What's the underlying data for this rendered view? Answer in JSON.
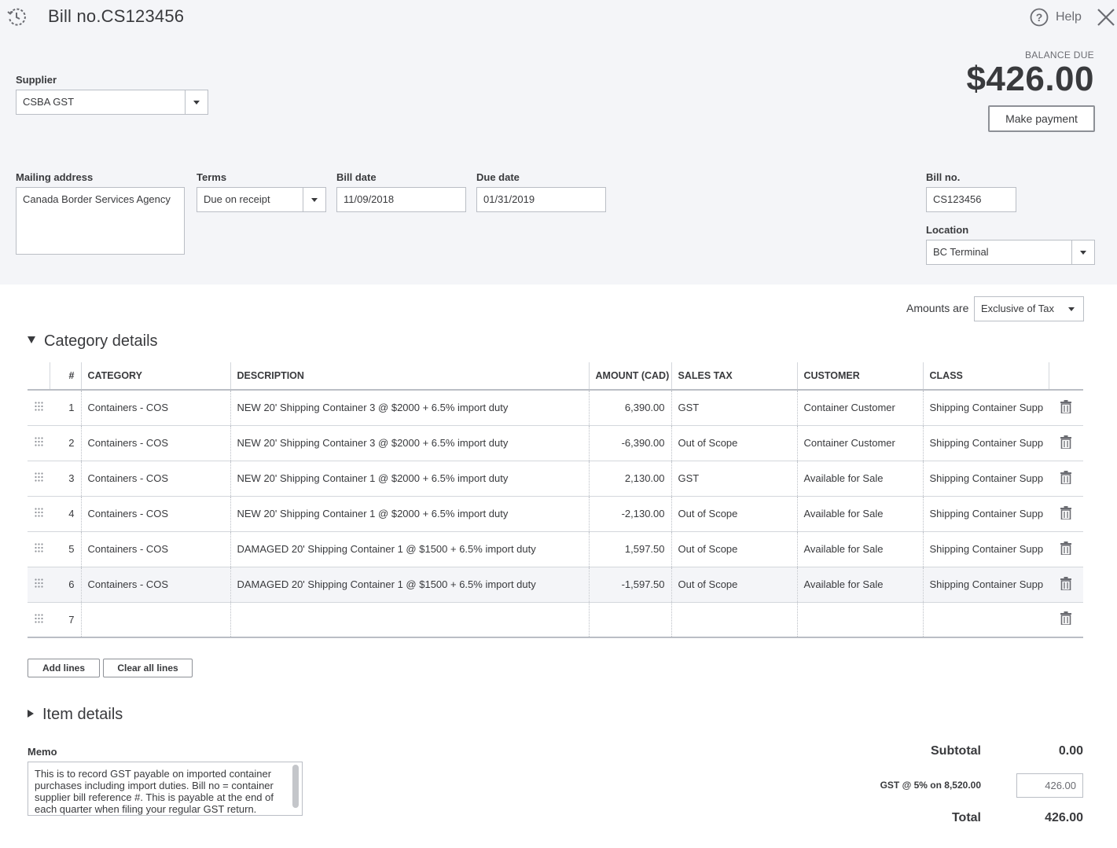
{
  "header": {
    "title": "Bill no.CS123456",
    "help_label": "Help",
    "icons": {
      "history": "history-icon",
      "help": "help-icon",
      "close": "close-icon"
    }
  },
  "supplier": {
    "label": "Supplier",
    "value": "CSBA GST"
  },
  "balance": {
    "label": "BALANCE DUE",
    "value": "$426.00",
    "button": "Make payment"
  },
  "mailing_address": {
    "label": "Mailing address",
    "value": "Canada Border Services Agency"
  },
  "terms": {
    "label": "Terms",
    "value": "Due on receipt"
  },
  "bill_date": {
    "label": "Bill date",
    "value": "11/09/2018"
  },
  "due_date": {
    "label": "Due date",
    "value": "01/31/2019"
  },
  "bill_no": {
    "label": "Bill no.",
    "value": "CS123456"
  },
  "location": {
    "label": "Location",
    "value": "BC Terminal"
  },
  "amounts_are": {
    "label": "Amounts are",
    "value": "Exclusive of Tax"
  },
  "category_details": {
    "title": "Category details",
    "columns": {
      "num": "#",
      "category": "CATEGORY",
      "description": "DESCRIPTION",
      "amount": "AMOUNT (CAD)",
      "sales_tax": "SALES TAX",
      "customer": "CUSTOMER",
      "class": "CLASS"
    },
    "rows": [
      {
        "num": "1",
        "category": "Containers - COS",
        "description": "NEW 20' Shipping Container 3 @ $2000 + 6.5% import duty",
        "amount": "6,390.00",
        "sales_tax": "GST",
        "customer": "Container Customer",
        "class": "Shipping Container Supp"
      },
      {
        "num": "2",
        "category": "Containers - COS",
        "description": "NEW 20' Shipping Container 3 @ $2000  + 6.5% import duty",
        "amount": "-6,390.00",
        "sales_tax": "Out of Scope",
        "customer": "Container Customer",
        "class": "Shipping Container Supp"
      },
      {
        "num": "3",
        "category": "Containers - COS",
        "description": "NEW 20' Shipping Container 1 @ $2000  + 6.5% import duty",
        "amount": "2,130.00",
        "sales_tax": "GST",
        "customer": "Available for Sale",
        "class": "Shipping Container Supp"
      },
      {
        "num": "4",
        "category": "Containers - COS",
        "description": "NEW 20' Shipping Container 1 @ $2000 + 6.5% import duty",
        "amount": "-2,130.00",
        "sales_tax": "Out of Scope",
        "customer": "Available for Sale",
        "class": "Shipping Container Supp"
      },
      {
        "num": "5",
        "category": "Containers - COS",
        "description": "DAMAGED  20' Shipping Container 1 @ $1500  + 6.5% import duty",
        "amount": "1,597.50",
        "sales_tax": "Out of Scope",
        "customer": "Available for Sale",
        "class": "Shipping Container Supp"
      },
      {
        "num": "6",
        "category": "Containers - COS",
        "description": "DAMAGED  20' Shipping Container 1 @ $1500  + 6.5% import duty",
        "amount": "-1,597.50",
        "sales_tax": "Out of Scope",
        "customer": "Available for Sale",
        "class": "Shipping Container Supp"
      },
      {
        "num": "7",
        "category": "",
        "description": "",
        "amount": "",
        "sales_tax": "",
        "customer": "",
        "class": ""
      }
    ],
    "add_lines": "Add lines",
    "clear_all_lines": "Clear all lines"
  },
  "item_details": {
    "title": "Item details"
  },
  "memo": {
    "label": "Memo",
    "value": "This is to record GST payable on imported container purchases including import duties. Bill no = container supplier bill reference #. This is payable at the end of each quarter when filing your regular GST return."
  },
  "totals": {
    "subtotal_label": "Subtotal",
    "subtotal_value": "0.00",
    "gst_label": "GST @ 5% on 8,520.00",
    "gst_value": "426.00",
    "total_label": "Total",
    "total_value": "426.00"
  }
}
